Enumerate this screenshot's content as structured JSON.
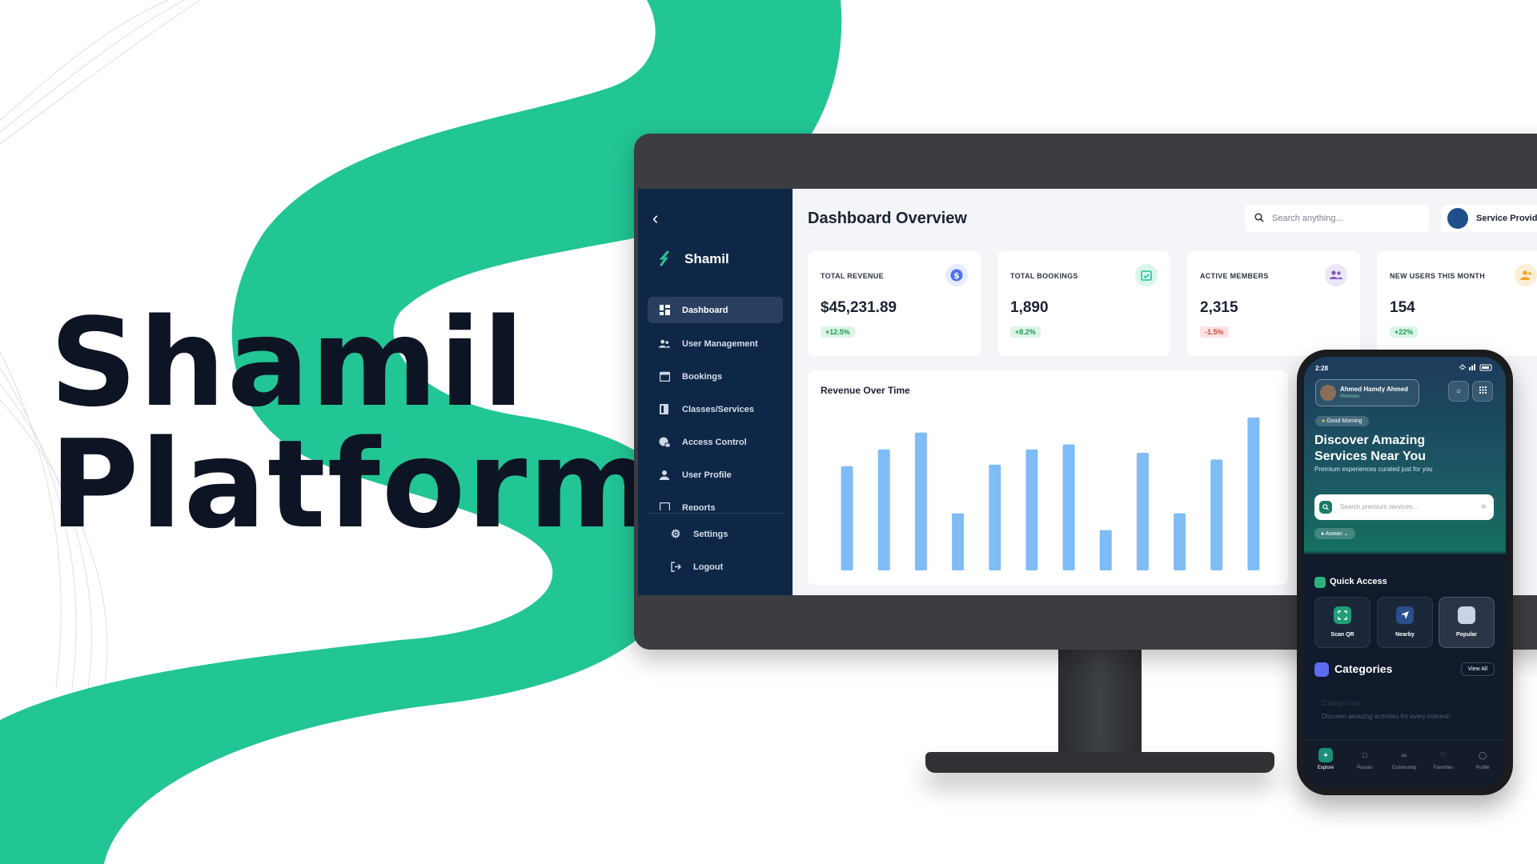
{
  "hero": {
    "line1": "Shamil",
    "line2": "Platform"
  },
  "dashboard": {
    "back_icon": "chevron-left-icon",
    "brand": "Shamil",
    "sidebar": {
      "items": [
        {
          "label": "Dashboard",
          "icon": "grid-icon",
          "active": true
        },
        {
          "label": "User Management",
          "icon": "users-icon"
        },
        {
          "label": "Bookings",
          "icon": "calendar-icon"
        },
        {
          "label": "Classes/Services",
          "icon": "book-icon"
        },
        {
          "label": "Access Control",
          "icon": "lock-icon"
        },
        {
          "label": "User Profile",
          "icon": "person-icon"
        },
        {
          "label": "Reports",
          "icon": "report-icon"
        }
      ],
      "bottom_items": [
        {
          "label": "Settings",
          "icon": "gear-icon"
        },
        {
          "label": "Logout",
          "icon": "logout-icon"
        }
      ]
    },
    "title": "Dashboard Overview",
    "search_placeholder": "Search anything...",
    "provider_label": "Service Provid",
    "stats": [
      {
        "label": "TOTAL REVENUE",
        "value": "$45,231.89",
        "change": "+12.5%",
        "trend": "up",
        "color": "#4f6ef7"
      },
      {
        "label": "TOTAL BOOKINGS",
        "value": "1,890",
        "change": "+8.2%",
        "trend": "up",
        "color": "#22c594"
      },
      {
        "label": "ACTIVE MEMBERS",
        "value": "2,315",
        "change": "-1.5%",
        "trend": "down",
        "color": "#7c5cc4"
      },
      {
        "label": "NEW USERS THIS MONTH",
        "value": "154",
        "change": "+22%",
        "trend": "up",
        "color": "#f5a524"
      }
    ],
    "chart_title": "Revenue Over Time"
  },
  "chart_data": {
    "type": "bar",
    "title": "Revenue Over Time",
    "values": [
      62,
      72,
      82,
      34,
      63,
      72,
      75,
      24,
      70,
      34,
      66,
      91
    ],
    "ylim": [
      0,
      100
    ],
    "grid": false,
    "color": "#7fbcf5"
  },
  "mobile": {
    "status_time": "2:28",
    "user_name": "Ahmed Hamdy Ahmed",
    "user_status": "Premium",
    "greeting": "Good Morning",
    "headline": "Discover Amazing Services Near You",
    "subtitle": "Premium experiences curated just for you",
    "search_placeholder": "Search premium services...",
    "location": "Aswan",
    "quick_access_title": "Quick Access",
    "quick_access": [
      {
        "label": "Scan QR",
        "icon": "qr-icon",
        "color": "#1f9e78"
      },
      {
        "label": "Nearby",
        "icon": "navigation-icon",
        "color": "#2a4f8a"
      },
      {
        "label": "Popular",
        "icon": "star-icon",
        "color": "#c8d4e6"
      }
    ],
    "categories_title": "Categories",
    "view_all": "View All",
    "categories_ghost": "Categories",
    "categories_desc": "Discover amazing activities for every interest!",
    "nav": [
      {
        "label": "Explore",
        "icon": "compass-icon",
        "active": true
      },
      {
        "label": "Passes",
        "icon": "ticket-icon"
      },
      {
        "label": "Community",
        "icon": "community-icon"
      },
      {
        "label": "Favorites",
        "icon": "heart-icon"
      },
      {
        "label": "Profile",
        "icon": "profile-icon"
      }
    ]
  }
}
